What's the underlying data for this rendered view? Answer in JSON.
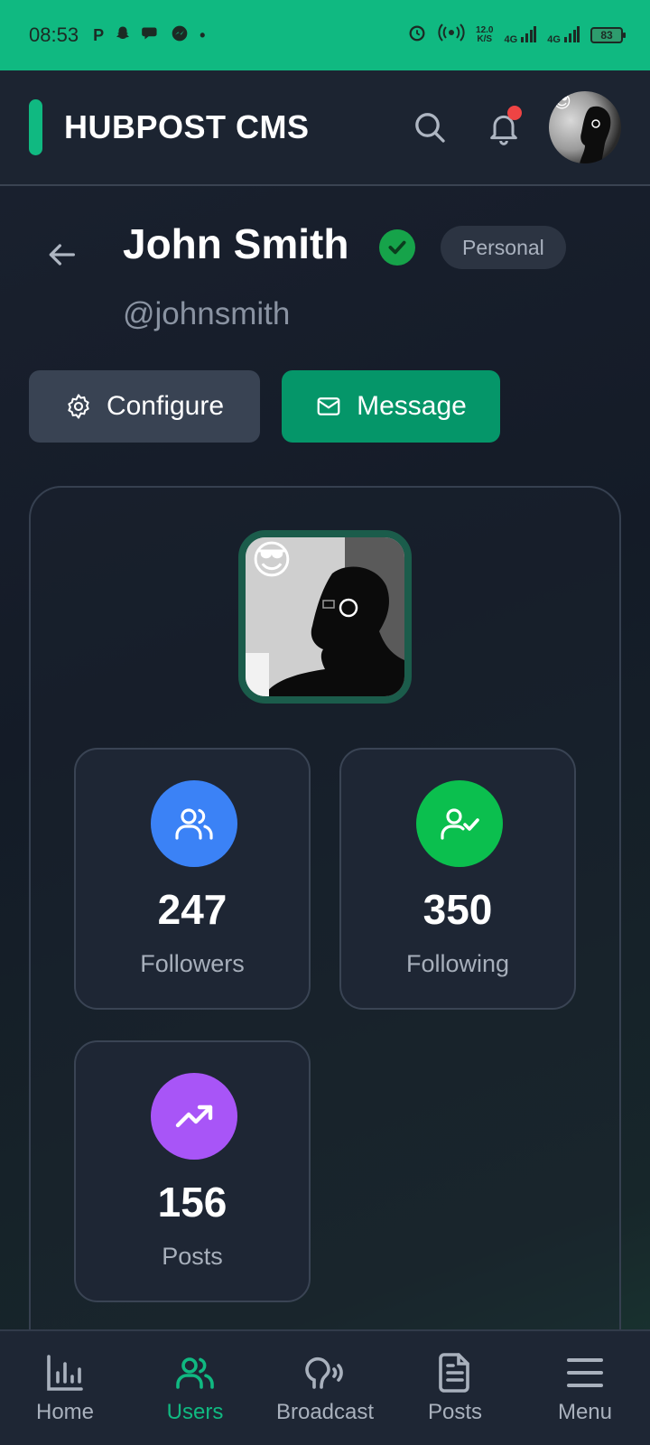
{
  "status_bar": {
    "time": "08:53",
    "left_icons": [
      "p-icon",
      "snapchat-icon",
      "chat-icon",
      "messenger-icon",
      "dot-icon"
    ],
    "speed_top": "12.0",
    "speed_bottom": "K/S",
    "net1": "4G",
    "net2": "4G",
    "battery": "83"
  },
  "header": {
    "title": "HUBPOST CMS",
    "accent_color": "#10b981",
    "has_notification": true
  },
  "profile": {
    "name": "John Smith",
    "handle": "@johnsmith",
    "account_type": "Personal",
    "verified": true
  },
  "actions": {
    "configure_label": "Configure",
    "message_label": "Message"
  },
  "stats": {
    "followers": {
      "value": "247",
      "label": "Followers",
      "color": "#3b82f6",
      "icon": "users-icon"
    },
    "following": {
      "value": "350",
      "label": "Following",
      "color": "#10b981",
      "icon": "user-check-icon"
    },
    "posts": {
      "value": "156",
      "label": "Posts",
      "color": "#a855f7",
      "icon": "trending-up-icon"
    }
  },
  "nav": {
    "items": [
      {
        "label": "Home",
        "icon": "bar-chart-icon",
        "active": false
      },
      {
        "label": "Users",
        "icon": "users-icon",
        "active": true
      },
      {
        "label": "Broadcast",
        "icon": "broadcast-icon",
        "active": false
      },
      {
        "label": "Posts",
        "icon": "document-icon",
        "active": false
      },
      {
        "label": "Menu",
        "icon": "menu-icon",
        "active": false
      }
    ]
  }
}
